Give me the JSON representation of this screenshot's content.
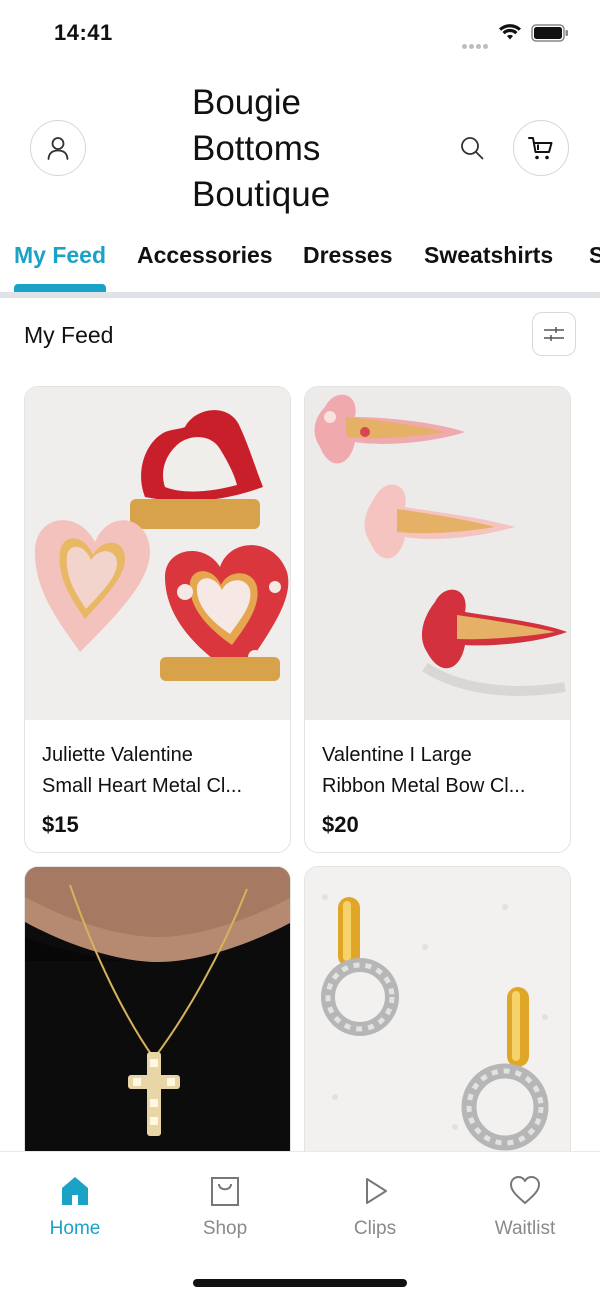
{
  "status_bar": {
    "time": "14:41"
  },
  "header": {
    "title": "Bougie Bottoms Boutique",
    "title_lines": [
      "Bougie",
      "Bottoms",
      "Boutique"
    ],
    "icons": [
      "profile-icon",
      "search-icon",
      "cart-icon"
    ]
  },
  "tabs": [
    {
      "label": "My Feed",
      "active": true
    },
    {
      "label": "Accessories"
    },
    {
      "label": "Dresses"
    },
    {
      "label": "Sweatshirts"
    },
    {
      "label": "S"
    }
  ],
  "feed": {
    "title": "My Feed",
    "filter_icon": "sliders-icon",
    "products": [
      {
        "name_line1": "Juliette Valentine",
        "name_line2": "Small Heart Metal Cl...",
        "price": "$15"
      },
      {
        "name_line1": "Valentine I Large",
        "name_line2": "Ribbon Metal Bow Cl...",
        "price": "$20"
      },
      {
        "name_line1": "",
        "name_line2": "",
        "price": ""
      },
      {
        "name_line1": "",
        "name_line2": "",
        "price": ""
      }
    ]
  },
  "bottom_nav": [
    {
      "label": "Home",
      "icon": "home-icon",
      "active": true
    },
    {
      "label": "Shop",
      "icon": "shopping-bag-icon"
    },
    {
      "label": "Clips",
      "icon": "play-icon"
    },
    {
      "label": "Waitlist",
      "icon": "heart-icon"
    }
  ],
  "colors": {
    "accent": "#1aa3c6",
    "text": "#111111",
    "muted": "#8a8a8a",
    "divider": "#dfe3e7"
  }
}
